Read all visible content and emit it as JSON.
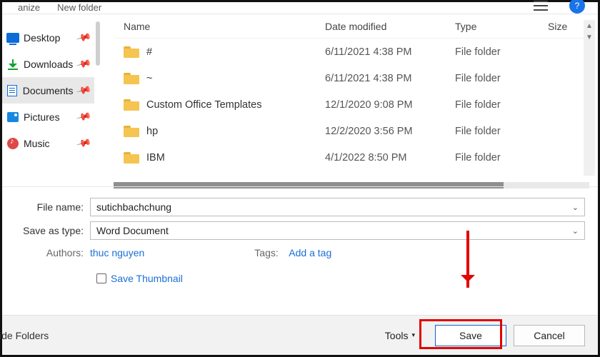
{
  "toolbar": {
    "organize": "anize",
    "newfolder": "New folder"
  },
  "nav": {
    "items": [
      {
        "label": "Desktop"
      },
      {
        "label": "Downloads"
      },
      {
        "label": "Documents"
      },
      {
        "label": "Pictures"
      },
      {
        "label": "Music"
      }
    ]
  },
  "columns": {
    "name": "Name",
    "date": "Date modified",
    "type": "Type",
    "size": "Size"
  },
  "rows": [
    {
      "name": "#",
      "date": "6/11/2021 4:38 PM",
      "type": "File folder"
    },
    {
      "name": "~",
      "date": "6/11/2021 4:38 PM",
      "type": "File folder"
    },
    {
      "name": "Custom Office Templates",
      "date": "12/1/2020 9:08 PM",
      "type": "File folder"
    },
    {
      "name": "hp",
      "date": "12/2/2020 3:56 PM",
      "type": "File folder"
    },
    {
      "name": "IBM",
      "date": "4/1/2022 8:50 PM",
      "type": "File folder"
    }
  ],
  "fields": {
    "filename_label": "File name:",
    "filename_value": "sutichbachchung",
    "saveastype_label": "Save as type:",
    "saveastype_value": "Word Document",
    "authors_label": "Authors:",
    "authors_value": "thuc nguyen",
    "tags_label": "Tags:",
    "tags_value": "Add a tag",
    "save_thumbnail": "Save Thumbnail"
  },
  "footer": {
    "hide_folders": "ide Folders",
    "tools": "Tools",
    "save": "Save",
    "cancel": "Cancel"
  }
}
